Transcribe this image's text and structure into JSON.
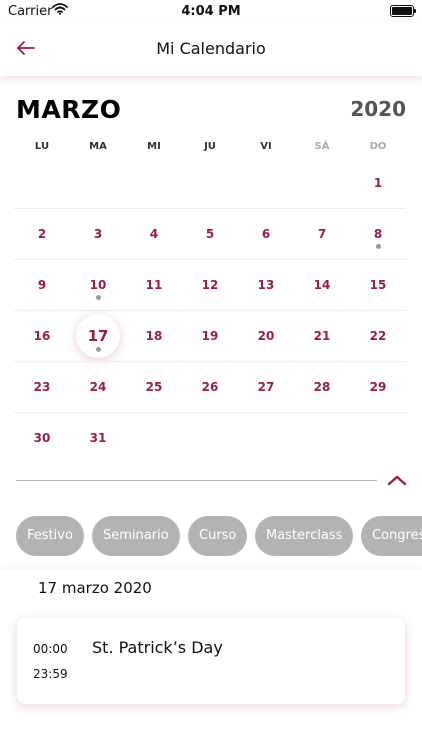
{
  "status_bar": {
    "carrier": "Carrier",
    "time": "4:04 PM"
  },
  "nav": {
    "title": "Mi Calendario",
    "back_icon": "arrow-left-icon"
  },
  "calendar": {
    "month": "MARZO",
    "year": "2020",
    "weekdays": [
      "LU",
      "MA",
      "MI",
      "JU",
      "VI",
      "SÁ",
      "DO"
    ],
    "weeks": [
      [
        "",
        "",
        "",
        "",
        "",
        "",
        "1"
      ],
      [
        "2",
        "3",
        "4",
        "5",
        "6",
        "7",
        "8"
      ],
      [
        "9",
        "10",
        "11",
        "12",
        "13",
        "14",
        "15"
      ],
      [
        "16",
        "17",
        "18",
        "19",
        "20",
        "21",
        "22"
      ],
      [
        "23",
        "24",
        "25",
        "26",
        "27",
        "28",
        "29"
      ],
      [
        "30",
        "31",
        "",
        "",
        "",
        "",
        ""
      ]
    ],
    "selected_day": "17",
    "days_with_events": [
      "8",
      "10",
      "17"
    ]
  },
  "filters": [
    "Festivo",
    "Seminario",
    "Curso",
    "Masterclass",
    "Congreso"
  ],
  "events_section": {
    "date": "17 marzo 2020",
    "events": [
      {
        "start": "00:00",
        "end": "23:59",
        "title": "St. Patrick’s Day"
      }
    ]
  },
  "colors": {
    "accent": "#9b1c4a",
    "chip_bg": "#b3b3b3",
    "dot": "#9a9a9a"
  }
}
